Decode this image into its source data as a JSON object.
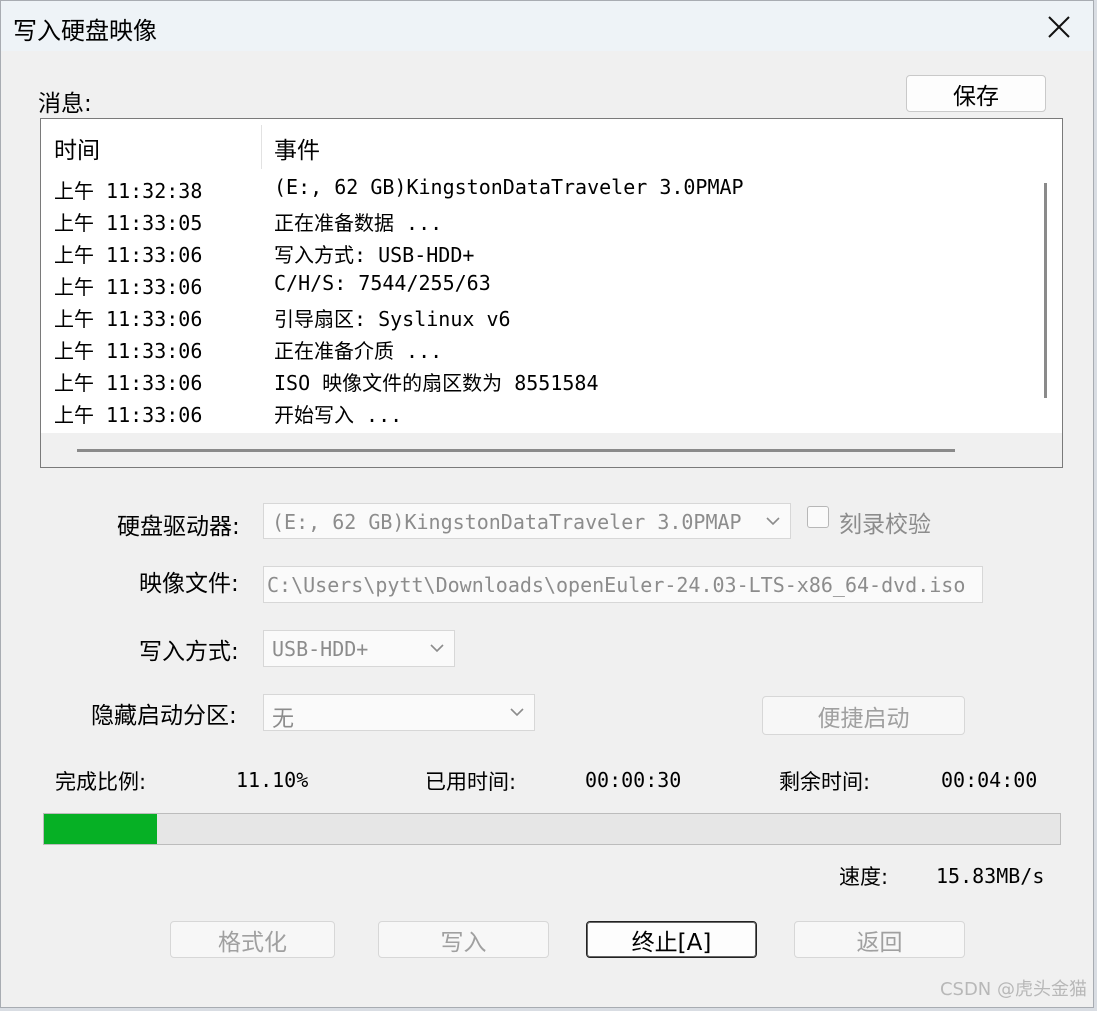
{
  "window": {
    "title": "写入硬盘映像"
  },
  "messages": {
    "label": "消息:",
    "save_label": "保存",
    "columns": [
      "时间",
      "事件"
    ],
    "rows": [
      {
        "time": "上午 11:32:38",
        "event": "(E:, 62 GB)KingstonDataTraveler 3.0PMAP"
      },
      {
        "time": "上午 11:33:05",
        "event": "正在准备数据 ..."
      },
      {
        "time": "上午 11:33:06",
        "event": "写入方式: USB-HDD+"
      },
      {
        "time": "上午 11:33:06",
        "event": "C/H/S: 7544/255/63"
      },
      {
        "time": "上午 11:33:06",
        "event": "引导扇区: Syslinux v6"
      },
      {
        "time": "上午 11:33:06",
        "event": "正在准备介质 ..."
      },
      {
        "time": "上午 11:33:06",
        "event": "ISO 映像文件的扇区数为 8551584"
      },
      {
        "time": "上午 11:33:06",
        "event": "开始写入 ..."
      }
    ]
  },
  "form": {
    "drive_label": "硬盘驱动器:",
    "drive_value": "(E:, 62 GB)KingstonDataTraveler 3.0PMAP",
    "verify_label": "刻录校验",
    "image_label": "映像文件:",
    "image_value": "C:\\Users\\pytt\\Downloads\\openEuler-24.03-LTS-x86_64-dvd.iso",
    "method_label": "写入方式:",
    "method_value": "USB-HDD+",
    "hidden_label": "隐藏启动分区:",
    "hidden_value": "无",
    "quick_boot_label": "便捷启动"
  },
  "status": {
    "progress_label": "完成比例:",
    "progress_value": "11.10%",
    "progress_fraction": 0.111,
    "elapsed_label": "已用时间:",
    "elapsed_value": "00:00:30",
    "remaining_label": "剩余时间:",
    "remaining_value": "00:04:00",
    "speed_label": "速度:",
    "speed_value": "15.83MB/s",
    "progress_color": "#06b025"
  },
  "buttons": {
    "format": "格式化",
    "write": "写入",
    "stop": "终止[A]",
    "back": "返回"
  },
  "watermark": "CSDN @虎头金猫"
}
